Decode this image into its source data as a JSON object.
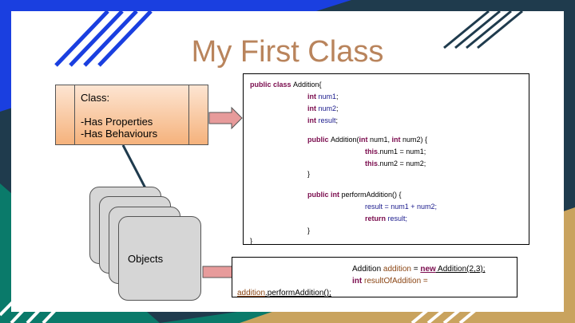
{
  "slide": {
    "title": "My First Class",
    "class_box": {
      "label": "Class:",
      "line1": "-Has Properties",
      "line2": "-Has Behaviours"
    },
    "objects_label": "Objects",
    "code": [
      [
        {
          "t": "public class ",
          "c": "kw"
        },
        {
          "t": "Addition{",
          "c": ""
        }
      ],
      [
        {
          "t": "int ",
          "c": "kw"
        },
        {
          "t": "num1",
          "c": "var"
        },
        {
          "t": ";",
          "c": ""
        }
      ],
      [
        {
          "t": "int ",
          "c": "kw"
        },
        {
          "t": "num2",
          "c": "var"
        },
        {
          "t": ";",
          "c": ""
        }
      ],
      [
        {
          "t": "int ",
          "c": "kw"
        },
        {
          "t": "result",
          "c": "var"
        },
        {
          "t": ";",
          "c": ""
        }
      ],
      [
        {
          "t": "public ",
          "c": "kw"
        },
        {
          "t": "Addition(",
          "c": ""
        },
        {
          "t": "int ",
          "c": "kw"
        },
        {
          "t": "num1, ",
          "c": ""
        },
        {
          "t": "int ",
          "c": "kw"
        },
        {
          "t": "num2) {",
          "c": ""
        }
      ],
      [
        {
          "t": "this",
          "c": "kw"
        },
        {
          "t": ".num1 = num1;",
          "c": ""
        }
      ],
      [
        {
          "t": "this",
          "c": "kw"
        },
        {
          "t": ".num2 = num2;",
          "c": ""
        }
      ],
      [
        {
          "t": "}",
          "c": ""
        }
      ],
      [
        {
          "t": "public int ",
          "c": "kw"
        },
        {
          "t": "performAddition() {",
          "c": ""
        }
      ],
      [
        {
          "t": "result = num1 + num2;",
          "c": "var"
        }
      ],
      [
        {
          "t": "return ",
          "c": "kw"
        },
        {
          "t": "result;",
          "c": "var"
        }
      ],
      [
        {
          "t": "}",
          "c": ""
        }
      ],
      [
        {
          "t": "}",
          "c": ""
        }
      ]
    ],
    "bottom_code": {
      "line1": [
        {
          "t": "Addition ",
          "c": ""
        },
        {
          "t": "addition",
          "c": "fv"
        },
        {
          "t": " = ",
          "c": ""
        },
        {
          "t": "new",
          "c": "kw u"
        },
        {
          "t": " Addition(2,3);",
          "c": "u"
        }
      ],
      "line2": [
        {
          "t": "int ",
          "c": "kw"
        },
        {
          "t": "resultOfAddition =",
          "c": "fv"
        }
      ],
      "line3": [
        {
          "t": "addition",
          "c": "fv u"
        },
        {
          "t": ".performAddition();",
          "c": "u"
        }
      ]
    }
  },
  "colors": {
    "title": "#b9845c",
    "class_box_top": "#fde5d2",
    "class_box_bottom": "#f5b27c",
    "arrow_fill": "#e79b9b",
    "blue_stripe": "#1a3fe0",
    "teal": "#0a7a6a",
    "gold": "#c9a35e",
    "navy": "#1f3b4d"
  }
}
